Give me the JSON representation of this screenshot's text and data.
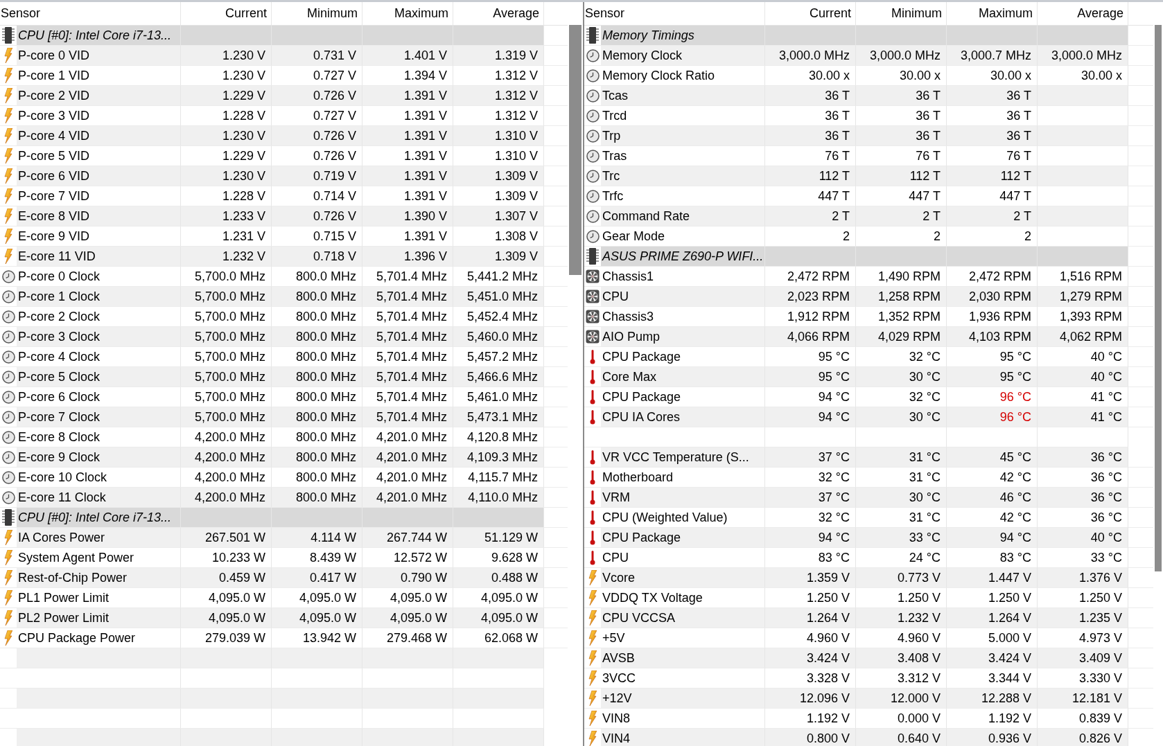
{
  "panels": [
    {
      "columns": [
        "Sensor",
        "Current",
        "Minimum",
        "Maximum",
        "Average"
      ],
      "rows": [
        {
          "kind": "group",
          "name": "CPU [#0]: Intel Core i7-13..."
        },
        {
          "kind": "voltage",
          "name": "P-core 0 VID",
          "values": [
            "1.230 V",
            "0.731 V",
            "1.401 V",
            "1.319 V"
          ],
          "max_alert": false
        },
        {
          "kind": "voltage",
          "name": "P-core 1 VID",
          "values": [
            "1.230 V",
            "0.727 V",
            "1.394 V",
            "1.312 V"
          ],
          "max_alert": false
        },
        {
          "kind": "voltage",
          "name": "P-core 2 VID",
          "values": [
            "1.229 V",
            "0.726 V",
            "1.391 V",
            "1.312 V"
          ],
          "max_alert": false
        },
        {
          "kind": "voltage",
          "name": "P-core 3 VID",
          "values": [
            "1.228 V",
            "0.727 V",
            "1.391 V",
            "1.312 V"
          ],
          "max_alert": false
        },
        {
          "kind": "voltage",
          "name": "P-core 4 VID",
          "values": [
            "1.230 V",
            "0.726 V",
            "1.391 V",
            "1.310 V"
          ],
          "max_alert": false
        },
        {
          "kind": "voltage",
          "name": "P-core 5 VID",
          "values": [
            "1.229 V",
            "0.726 V",
            "1.391 V",
            "1.310 V"
          ],
          "max_alert": false
        },
        {
          "kind": "voltage",
          "name": "P-core 6 VID",
          "values": [
            "1.230 V",
            "0.719 V",
            "1.391 V",
            "1.309 V"
          ],
          "max_alert": false
        },
        {
          "kind": "voltage",
          "name": "P-core 7 VID",
          "values": [
            "1.228 V",
            "0.714 V",
            "1.391 V",
            "1.309 V"
          ],
          "max_alert": false
        },
        {
          "kind": "voltage",
          "name": "E-core 8 VID",
          "values": [
            "1.233 V",
            "0.726 V",
            "1.390 V",
            "1.307 V"
          ],
          "max_alert": false
        },
        {
          "kind": "voltage",
          "name": "E-core 9 VID",
          "values": [
            "1.231 V",
            "0.715 V",
            "1.391 V",
            "1.308 V"
          ],
          "max_alert": false
        },
        {
          "kind": "voltage",
          "name": "E-core 11 VID",
          "values": [
            "1.232 V",
            "0.718 V",
            "1.396 V",
            "1.309 V"
          ],
          "max_alert": false
        },
        {
          "kind": "clock",
          "name": "P-core 0 Clock",
          "values": [
            "5,700.0 MHz",
            "800.0 MHz",
            "5,701.4 MHz",
            "5,441.2 MHz"
          ],
          "max_alert": false
        },
        {
          "kind": "clock",
          "name": "P-core 1 Clock",
          "values": [
            "5,700.0 MHz",
            "800.0 MHz",
            "5,701.4 MHz",
            "5,451.0 MHz"
          ],
          "max_alert": false
        },
        {
          "kind": "clock",
          "name": "P-core 2 Clock",
          "values": [
            "5,700.0 MHz",
            "800.0 MHz",
            "5,701.4 MHz",
            "5,452.4 MHz"
          ],
          "max_alert": false
        },
        {
          "kind": "clock",
          "name": "P-core 3 Clock",
          "values": [
            "5,700.0 MHz",
            "800.0 MHz",
            "5,701.4 MHz",
            "5,460.0 MHz"
          ],
          "max_alert": false
        },
        {
          "kind": "clock",
          "name": "P-core 4 Clock",
          "values": [
            "5,700.0 MHz",
            "800.0 MHz",
            "5,701.4 MHz",
            "5,457.2 MHz"
          ],
          "max_alert": false
        },
        {
          "kind": "clock",
          "name": "P-core 5 Clock",
          "values": [
            "5,700.0 MHz",
            "800.0 MHz",
            "5,701.4 MHz",
            "5,466.6 MHz"
          ],
          "max_alert": false
        },
        {
          "kind": "clock",
          "name": "P-core 6 Clock",
          "values": [
            "5,700.0 MHz",
            "800.0 MHz",
            "5,701.4 MHz",
            "5,461.0 MHz"
          ],
          "max_alert": false
        },
        {
          "kind": "clock",
          "name": "P-core 7 Clock",
          "values": [
            "5,700.0 MHz",
            "800.0 MHz",
            "5,701.4 MHz",
            "5,473.1 MHz"
          ],
          "max_alert": false
        },
        {
          "kind": "clock",
          "name": "E-core 8 Clock",
          "values": [
            "4,200.0 MHz",
            "800.0 MHz",
            "4,201.0 MHz",
            "4,120.8 MHz"
          ],
          "max_alert": false
        },
        {
          "kind": "clock",
          "name": "E-core 9 Clock",
          "values": [
            "4,200.0 MHz",
            "800.0 MHz",
            "4,201.0 MHz",
            "4,109.3 MHz"
          ],
          "max_alert": false
        },
        {
          "kind": "clock",
          "name": "E-core 10 Clock",
          "values": [
            "4,200.0 MHz",
            "800.0 MHz",
            "4,201.0 MHz",
            "4,115.7 MHz"
          ],
          "max_alert": false
        },
        {
          "kind": "clock",
          "name": "E-core 11 Clock",
          "values": [
            "4,200.0 MHz",
            "800.0 MHz",
            "4,201.0 MHz",
            "4,110.0 MHz"
          ],
          "max_alert": false
        },
        {
          "kind": "group",
          "name": "CPU [#0]: Intel Core i7-13..."
        },
        {
          "kind": "voltage",
          "name": "IA Cores Power",
          "values": [
            "267.501 W",
            "4.114 W",
            "267.744 W",
            "51.129 W"
          ],
          "max_alert": false
        },
        {
          "kind": "voltage",
          "name": "System Agent Power",
          "values": [
            "10.233 W",
            "8.439 W",
            "12.572 W",
            "9.628 W"
          ],
          "max_alert": false
        },
        {
          "kind": "voltage",
          "name": "Rest-of-Chip Power",
          "values": [
            "0.459 W",
            "0.417 W",
            "0.790 W",
            "0.488 W"
          ],
          "max_alert": false
        },
        {
          "kind": "voltage",
          "name": "PL1 Power Limit",
          "values": [
            "4,095.0 W",
            "4,095.0 W",
            "4,095.0 W",
            "4,095.0 W"
          ],
          "max_alert": false
        },
        {
          "kind": "voltage",
          "name": "PL2 Power Limit",
          "values": [
            "4,095.0 W",
            "4,095.0 W",
            "4,095.0 W",
            "4,095.0 W"
          ],
          "max_alert": false
        },
        {
          "kind": "voltage",
          "name": "CPU Package Power",
          "values": [
            "279.039 W",
            "13.942 W",
            "279.468 W",
            "62.068 W"
          ],
          "max_alert": false
        }
      ]
    },
    {
      "columns": [
        "Sensor",
        "Current",
        "Minimum",
        "Maximum",
        "Average"
      ],
      "rows": [
        {
          "kind": "group",
          "name": "Memory Timings"
        },
        {
          "kind": "clock",
          "name": "Memory Clock",
          "values": [
            "3,000.0 MHz",
            "3,000.0 MHz",
            "3,000.7 MHz",
            "3,000.0 MHz"
          ],
          "max_alert": false
        },
        {
          "kind": "clock",
          "name": "Memory Clock Ratio",
          "values": [
            "30.00 x",
            "30.00 x",
            "30.00 x",
            "30.00 x"
          ],
          "max_alert": false
        },
        {
          "kind": "clock",
          "name": "Tcas",
          "values": [
            "36 T",
            "36 T",
            "36 T"
          ],
          "max_alert": false
        },
        {
          "kind": "clock",
          "name": "Trcd",
          "values": [
            "36 T",
            "36 T",
            "36 T"
          ],
          "max_alert": false
        },
        {
          "kind": "clock",
          "name": "Trp",
          "values": [
            "36 T",
            "36 T",
            "36 T"
          ],
          "max_alert": false
        },
        {
          "kind": "clock",
          "name": "Tras",
          "values": [
            "76 T",
            "76 T",
            "76 T"
          ],
          "max_alert": false
        },
        {
          "kind": "clock",
          "name": "Trc",
          "values": [
            "112 T",
            "112 T",
            "112 T"
          ],
          "max_alert": false
        },
        {
          "kind": "clock",
          "name": "Trfc",
          "values": [
            "447 T",
            "447 T",
            "447 T"
          ],
          "max_alert": false
        },
        {
          "kind": "clock",
          "name": "Command Rate",
          "values": [
            "2 T",
            "2 T",
            "2 T"
          ],
          "max_alert": false
        },
        {
          "kind": "clock",
          "name": "Gear Mode",
          "values": [
            "2",
            "2",
            "2"
          ],
          "max_alert": false
        },
        {
          "kind": "group",
          "name": "ASUS PRIME Z690-P WIFI..."
        },
        {
          "kind": "fan",
          "name": "Chassis1",
          "values": [
            "2,472 RPM",
            "1,490 RPM",
            "2,472 RPM",
            "1,516 RPM"
          ],
          "max_alert": false
        },
        {
          "kind": "fan",
          "name": "CPU",
          "values": [
            "2,023 RPM",
            "1,258 RPM",
            "2,030 RPM",
            "1,279 RPM"
          ],
          "max_alert": false
        },
        {
          "kind": "fan",
          "name": "Chassis3",
          "values": [
            "1,912 RPM",
            "1,352 RPM",
            "1,936 RPM",
            "1,393 RPM"
          ],
          "max_alert": false
        },
        {
          "kind": "fan",
          "name": "AIO Pump",
          "values": [
            "4,066 RPM",
            "4,029 RPM",
            "4,103 RPM",
            "4,062 RPM"
          ],
          "max_alert": false
        },
        {
          "kind": "temperature",
          "name": "CPU Package",
          "values": [
            "95 °C",
            "32 °C",
            "95 °C",
            "40 °C"
          ],
          "max_alert": false
        },
        {
          "kind": "temperature",
          "name": "Core Max",
          "values": [
            "95 °C",
            "30 °C",
            "95 °C",
            "40 °C"
          ],
          "max_alert": false
        },
        {
          "kind": "temperature",
          "name": "CPU Package",
          "values": [
            "94 °C",
            "32 °C",
            "96 °C",
            "41 °C"
          ],
          "max_alert": true
        },
        {
          "kind": "temperature",
          "name": "CPU IA Cores",
          "values": [
            "94 °C",
            "30 °C",
            "96 °C",
            "41 °C"
          ],
          "max_alert": true
        },
        {
          "kind": "blank"
        },
        {
          "kind": "temperature",
          "name": "VR VCC Temperature (S...",
          "values": [
            "37 °C",
            "31 °C",
            "45 °C",
            "36 °C"
          ],
          "max_alert": false
        },
        {
          "kind": "temperature",
          "name": "Motherboard",
          "values": [
            "32 °C",
            "31 °C",
            "42 °C",
            "36 °C"
          ],
          "max_alert": false
        },
        {
          "kind": "temperature",
          "name": "VRM",
          "values": [
            "37 °C",
            "30 °C",
            "46 °C",
            "36 °C"
          ],
          "max_alert": false
        },
        {
          "kind": "temperature",
          "name": "CPU (Weighted Value)",
          "values": [
            "32 °C",
            "31 °C",
            "42 °C",
            "36 °C"
          ],
          "max_alert": false
        },
        {
          "kind": "temperature",
          "name": "CPU Package",
          "values": [
            "94 °C",
            "33 °C",
            "94 °C",
            "40 °C"
          ],
          "max_alert": false
        },
        {
          "kind": "temperature",
          "name": "CPU",
          "values": [
            "83 °C",
            "24 °C",
            "83 °C",
            "33 °C"
          ],
          "max_alert": false
        },
        {
          "kind": "voltage",
          "name": "Vcore",
          "values": [
            "1.359 V",
            "0.773 V",
            "1.447 V",
            "1.376 V"
          ],
          "max_alert": false
        },
        {
          "kind": "voltage",
          "name": "VDDQ TX Voltage",
          "values": [
            "1.250 V",
            "1.250 V",
            "1.250 V",
            "1.250 V"
          ],
          "max_alert": false
        },
        {
          "kind": "voltage",
          "name": "CPU VCCSA",
          "values": [
            "1.264 V",
            "1.232 V",
            "1.264 V",
            "1.235 V"
          ],
          "max_alert": false
        },
        {
          "kind": "voltage",
          "name": "+5V",
          "values": [
            "4.960 V",
            "4.960 V",
            "5.000 V",
            "4.973 V"
          ],
          "max_alert": false
        },
        {
          "kind": "voltage",
          "name": "AVSB",
          "values": [
            "3.424 V",
            "3.408 V",
            "3.424 V",
            "3.409 V"
          ],
          "max_alert": false
        },
        {
          "kind": "voltage",
          "name": "3VCC",
          "values": [
            "3.328 V",
            "3.312 V",
            "3.344 V",
            "3.330 V"
          ],
          "max_alert": false
        },
        {
          "kind": "voltage",
          "name": "+12V",
          "values": [
            "12.096 V",
            "12.000 V",
            "12.288 V",
            "12.181 V"
          ],
          "max_alert": false
        },
        {
          "kind": "voltage",
          "name": "VIN8",
          "values": [
            "1.192 V",
            "0.000 V",
            "1.192 V",
            "0.839 V"
          ],
          "max_alert": false
        },
        {
          "kind": "voltage",
          "name": "VIN4",
          "values": [
            "0.800 V",
            "0.640 V",
            "0.936 V",
            "0.826 V"
          ],
          "max_alert": false
        }
      ]
    }
  ]
}
